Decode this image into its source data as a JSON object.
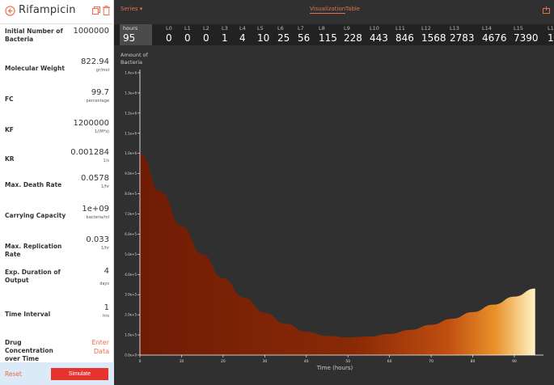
{
  "sidebar": {
    "title": "Rifampicin",
    "params": [
      {
        "label": "Initial Number of Bacteria",
        "value": "1000000",
        "unit": ""
      },
      {
        "label": "Molecular Weight",
        "value": "822.94",
        "unit": "gr/mol"
      },
      {
        "label": "FC",
        "value": "99.7",
        "unit": "percentage"
      },
      {
        "label": "KF",
        "value": "1200000",
        "unit": "1/(M*s)"
      },
      {
        "label": "KR",
        "value": "0.001284",
        "unit": "1/s"
      },
      {
        "label": "Max. Death Rate",
        "value": "0.0578",
        "unit": "1/hr"
      },
      {
        "label": "Carrying Capacity",
        "value": "1e+09",
        "unit": "bacteria/ml"
      },
      {
        "label": "Max. Replication Rate",
        "value": "0.033",
        "unit": "1/hr"
      },
      {
        "label": "Exp. Duration of Output",
        "value": "4",
        "unit": "days"
      },
      {
        "label": "Time Interval",
        "value": "1",
        "unit": "hrs"
      }
    ],
    "drug_conc": {
      "label": "Drug Concentration over Time",
      "link_line1": "Enter",
      "link_line2": "Data"
    },
    "reset_label": "Reset",
    "simulate_label": "Simulate"
  },
  "topbar": {
    "series_label": "Series ▾",
    "tab_visualization": "Visualization",
    "tab_table": "Table"
  },
  "levels": {
    "hours_label": "hours",
    "hours_value": "95",
    "items": [
      {
        "name": "L0",
        "value": "0"
      },
      {
        "name": "L1",
        "value": "0"
      },
      {
        "name": "L2",
        "value": "0"
      },
      {
        "name": "L3",
        "value": "1"
      },
      {
        "name": "L4",
        "value": "4"
      },
      {
        "name": "L5",
        "value": "10"
      },
      {
        "name": "L6",
        "value": "25"
      },
      {
        "name": "L7",
        "value": "56"
      },
      {
        "name": "L8",
        "value": "115"
      },
      {
        "name": "L9",
        "value": "228"
      },
      {
        "name": "L10",
        "value": "443"
      },
      {
        "name": "L11",
        "value": "846"
      },
      {
        "name": "L12",
        "value": "1568"
      },
      {
        "name": "L13",
        "value": "2783"
      },
      {
        "name": "L14",
        "value": "4676"
      },
      {
        "name": "L15",
        "value": "7390"
      },
      {
        "name": "L1",
        "value": "1"
      }
    ]
  },
  "chart_data": {
    "type": "area",
    "ylabel_line1": "Amount of",
    "ylabel_line2": "Bacteria",
    "xlabel": "Time (hours)",
    "xlim": [
      0,
      97
    ],
    "ylim": [
      0,
      1400000
    ],
    "y_ticks": [
      0,
      100000,
      200000,
      300000,
      400000,
      500000,
      600000,
      700000,
      800000,
      900000,
      1000000,
      1100000,
      1200000,
      1300000,
      1400000
    ],
    "y_tick_labels": [
      "0.0e+0",
      "1.0e+5",
      "2.0e+5",
      "3.0e+5",
      "4.0e+5",
      "5.0e+5",
      "6.0e+5",
      "7.0e+5",
      "8.0e+5",
      "9.0e+5",
      "1.0e+6",
      "1.1e+6",
      "1.2e+6",
      "1.3e+6",
      "1.4e+6"
    ],
    "x_ticks": [
      0,
      10,
      20,
      30,
      40,
      50,
      60,
      70,
      80,
      90
    ],
    "x_tick_labels": [
      "0",
      "10",
      "20",
      "30",
      "40",
      "50",
      "60",
      "70",
      "80",
      "90"
    ],
    "series": [
      {
        "values_x": [
          0,
          5,
          10,
          15,
          20,
          25,
          30,
          35,
          40,
          45,
          50,
          55,
          60,
          65,
          70,
          75,
          80,
          85,
          90,
          95
        ],
        "values_y": [
          1000000,
          810000,
          640000,
          500000,
          380000,
          285000,
          210000,
          155000,
          115000,
          95000,
          88000,
          92000,
          105000,
          125000,
          150000,
          180000,
          213000,
          250000,
          290000,
          330000
        ]
      }
    ],
    "colors": {
      "fill_dark": "#7a1f05",
      "fill_mid": "#c25010",
      "fill_light": "#fff3c6",
      "background": "#303030"
    }
  }
}
